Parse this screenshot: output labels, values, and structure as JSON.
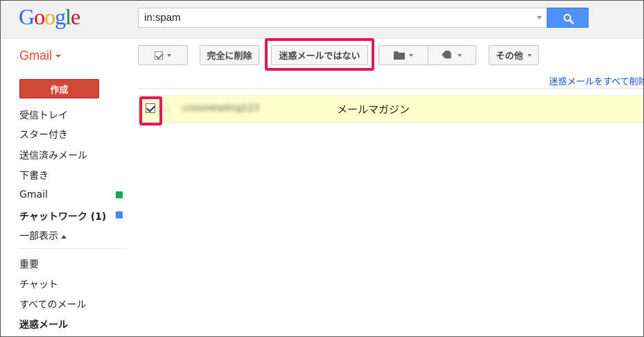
{
  "header": {
    "logo": {
      "letters": [
        "G",
        "o",
        "o",
        "g",
        "l",
        "e"
      ],
      "colors": [
        "#3369e8",
        "#d50f25",
        "#eeb211",
        "#3369e8",
        "#009925",
        "#d50f25"
      ]
    },
    "search": {
      "value": "in:spam",
      "button_icon": "search-icon"
    }
  },
  "app_menu": {
    "label": "Gmail"
  },
  "toolbar": {
    "select_icon": "checkbox-icon",
    "delete_forever": "完全に削除",
    "not_spam": "迷惑メールではない",
    "move_icon": "folder-icon",
    "labels_icon": "label-tag-icon",
    "more": "その他",
    "delete_all_spam_link": "迷惑メールをすべて削除"
  },
  "sidebar": {
    "compose": "作成",
    "items": [
      {
        "label": "受信トレイ"
      },
      {
        "label": "スター付き"
      },
      {
        "label": "送信済みメール"
      },
      {
        "label": "下書き"
      },
      {
        "label": "Gmail",
        "color": "#16a765"
      },
      {
        "label": "チャットワーク (1)",
        "color": "#4a86e8"
      },
      {
        "label": "一部表示"
      },
      {
        "label": "重要"
      },
      {
        "label": "チャット"
      },
      {
        "label": "すべてのメール"
      },
      {
        "label": "迷惑メール"
      }
    ]
  },
  "messages": [
    {
      "sender": "crossretailing123",
      "subject": "メールマガジン",
      "checked": true,
      "starred": false
    }
  ],
  "colors": {
    "highlight": "#e5155c",
    "row_background": "#ffffcc",
    "link": "#1155cc",
    "compose": "#d14836"
  }
}
